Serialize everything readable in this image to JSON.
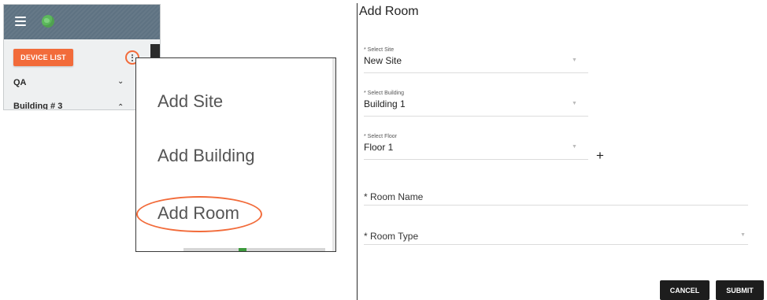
{
  "sidebar": {
    "device_list_label": "DEVICE LIST",
    "tree": [
      {
        "label": "QA",
        "expanded": false
      },
      {
        "label": "Building # 3",
        "expanded": true
      }
    ]
  },
  "context_menu": {
    "items": [
      "Add Site",
      "Add Building",
      "Add Room"
    ],
    "highlighted": "Add Room"
  },
  "dialog": {
    "title": "Add Room",
    "site": {
      "label": "* Select Site",
      "value": "New Site"
    },
    "building": {
      "label": "* Select Building",
      "value": "Building 1"
    },
    "floor": {
      "label": "* Select Floor",
      "value": "Floor 1"
    },
    "add_floor_symbol": "+",
    "room_name": {
      "label": "* Room Name",
      "value": ""
    },
    "room_type": {
      "label": "* Room Type",
      "value": ""
    },
    "cancel_label": "CANCEL",
    "submit_label": "SUBMIT"
  },
  "colors": {
    "accent": "#f26b3a",
    "topbar": "#5e7282",
    "button_dark": "#1d1d1d"
  },
  "icons": {
    "menu": "hamburger-icon",
    "globe": "globe-icon",
    "more": "kebab-menu-icon",
    "chevron_down": "chevron-down-icon",
    "chevron_up": "chevron-up-icon",
    "dropdown": "dropdown-caret-icon"
  }
}
